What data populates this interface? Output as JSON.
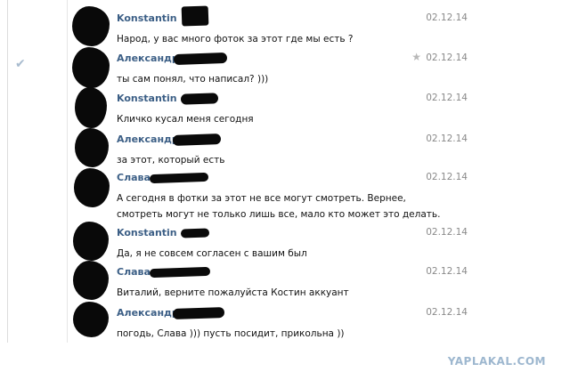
{
  "messages": [
    {
      "name": "Konstantin",
      "date": "02.12.14",
      "lines": [
        "Народ, у вас много фоток за этот где мы есть ?"
      ]
    },
    {
      "name": "Александр",
      "date": "02.12.14",
      "lines": [
        "ты сам понял, что написал? )))"
      ]
    },
    {
      "name": "Konstantin",
      "date": "02.12.14",
      "lines": [
        "Кличко кусал меня сегодня"
      ]
    },
    {
      "name": "Александр",
      "date": "02.12.14",
      "lines": [
        "за этот, который есть"
      ]
    },
    {
      "name": "Слава",
      "date": "02.12.14",
      "lines": [
        "А сегодня в фотки за этот не все могут смотреть. Вернее,",
        "смотреть могут не только лишь все, мало кто может это делать."
      ]
    },
    {
      "name": "Konstantin",
      "date": "02.12.14",
      "lines": [
        "Да, я не совсем согласен с вашим был"
      ]
    },
    {
      "name": "Слава",
      "date": "02.12.14",
      "lines": [
        "Виталий, верните пожалуйста Костин аккуант"
      ]
    },
    {
      "name": "Александр",
      "date": "02.12.14",
      "lines": [
        "погодь, Слава ))) пусть посидит, прикольна ))"
      ]
    }
  ],
  "icons": {
    "read_check": "check-icon",
    "favorite": "star-icon"
  },
  "watermark": "YAPLAKAL.COM"
}
